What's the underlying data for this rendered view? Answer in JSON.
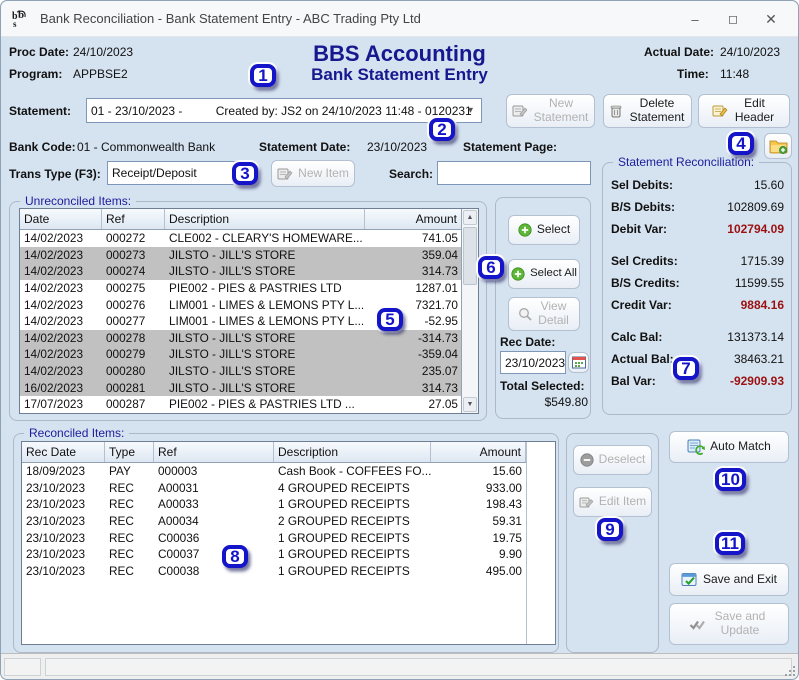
{
  "window": {
    "title": "Bank Reconciliation - Bank Statement Entry - ABC Trading Pty Ltd"
  },
  "header": {
    "proc_date_label": "Proc Date:",
    "proc_date": "24/10/2023",
    "program_label": "Program:",
    "program": "APPBSE2",
    "app_title": "BBS Accounting",
    "screen_title": "Bank Statement Entry",
    "actual_date_label": "Actual Date:",
    "actual_date": "24/10/2023",
    "time_label": "Time:",
    "time": "11:48"
  },
  "statement_bar": {
    "label": "Statement:",
    "value": "01 - 23/10/2023 -          Created by: JS2 on 24/10/2023 11:48 - 0120231",
    "new_statement": "New Statement",
    "delete_statement": "Delete Statement",
    "edit_header": "Edit Header"
  },
  "bank_row": {
    "bank_code_label": "Bank Code:",
    "bank_code": "01 - Commonwealth Bank",
    "statement_date_label": "Statement Date:",
    "statement_date": "23/10/2023",
    "statement_page_label": "Statement Page:",
    "statement_page": ""
  },
  "trans_row": {
    "trans_type_label": "Trans Type (F3):",
    "trans_type": "Receipt/Deposit",
    "new_item": "New Item",
    "search_label": "Search:",
    "search_value": ""
  },
  "unreconciled": {
    "title": "Unreconciled Items:",
    "columns": [
      "Date",
      "Ref",
      "Description",
      "Amount"
    ],
    "rows": [
      {
        "date": "14/02/2023",
        "ref": "000272",
        "description": "CLE002 - CLEARY'S HOMEWARE...",
        "amount": "741.05",
        "selected": false
      },
      {
        "date": "14/02/2023",
        "ref": "000273",
        "description": "JILSTO - JILL'S STORE",
        "amount": "359.04",
        "selected": true
      },
      {
        "date": "14/02/2023",
        "ref": "000274",
        "description": "JILSTO - JILL'S STORE",
        "amount": "314.73",
        "selected": true
      },
      {
        "date": "14/02/2023",
        "ref": "000275",
        "description": "PIE002 - PIES & PASTRIES LTD",
        "amount": "1287.01",
        "selected": false
      },
      {
        "date": "14/02/2023",
        "ref": "000276",
        "description": "LIM001 - LIMES & LEMONS PTY L...",
        "amount": "7321.70",
        "selected": false
      },
      {
        "date": "14/02/2023",
        "ref": "000277",
        "description": "LIM001 - LIMES & LEMONS PTY L...",
        "amount": "-52.95",
        "selected": false
      },
      {
        "date": "14/02/2023",
        "ref": "000278",
        "description": "JILSTO - JILL'S STORE",
        "amount": "-314.73",
        "selected": true
      },
      {
        "date": "14/02/2023",
        "ref": "000279",
        "description": "JILSTO - JILL'S STORE",
        "amount": "-359.04",
        "selected": true
      },
      {
        "date": "14/02/2023",
        "ref": "000280",
        "description": "JILSTO - JILL'S STORE",
        "amount": "235.07",
        "selected": true
      },
      {
        "date": "16/02/2023",
        "ref": "000281",
        "description": "JILSTO - JILL'S STORE",
        "amount": "314.73",
        "selected": true
      },
      {
        "date": "17/07/2023",
        "ref": "000287",
        "description": "PIE002 - PIES & PASTRIES LTD ...",
        "amount": "27.05",
        "selected": false
      }
    ],
    "select": "Select",
    "select_all": "Select All",
    "view_detail": "View Detail",
    "rec_date_label": "Rec Date:",
    "rec_date": "23/10/2023",
    "total_selected_label": "Total Selected:",
    "total_selected": "$549.80"
  },
  "reconciliation": {
    "title": "Statement Reconciliation:",
    "rows": [
      {
        "label": "Sel Debits:",
        "value": "15.60",
        "red": false,
        "gap": false
      },
      {
        "label": "B/S Debits:",
        "value": "102809.69",
        "red": false,
        "gap": false
      },
      {
        "label": "Debit Var:",
        "value": "102794.09",
        "red": true,
        "gap": false
      },
      {
        "label": "Sel Credits:",
        "value": "1715.39",
        "red": false,
        "gap": true
      },
      {
        "label": "B/S Credits:",
        "value": "11599.55",
        "red": false,
        "gap": false
      },
      {
        "label": "Credit Var:",
        "value": "9884.16",
        "red": true,
        "gap": false
      },
      {
        "label": "Calc Bal:",
        "value": "131373.14",
        "red": false,
        "gap": true
      },
      {
        "label": "Actual Bal:",
        "value": "38463.21",
        "red": false,
        "gap": false
      },
      {
        "label": "Bal Var:",
        "value": "-92909.93",
        "red": true,
        "gap": false
      }
    ]
  },
  "reconciled": {
    "title": "Reconciled Items:",
    "columns": [
      "Rec Date",
      "Type",
      "Ref",
      "Description",
      "Amount"
    ],
    "rows": [
      {
        "rec_date": "18/09/2023",
        "type": "PAY",
        "ref": "000003",
        "description": "Cash Book - COFFEES FO...",
        "amount": "15.60"
      },
      {
        "rec_date": "23/10/2023",
        "type": "REC",
        "ref": "A00031",
        "description": "4 GROUPED RECEIPTS",
        "amount": "933.00"
      },
      {
        "rec_date": "23/10/2023",
        "type": "REC",
        "ref": "A00033",
        "description": "1 GROUPED RECEIPTS",
        "amount": "198.43"
      },
      {
        "rec_date": "23/10/2023",
        "type": "REC",
        "ref": "A00034",
        "description": "2 GROUPED RECEIPTS",
        "amount": "59.31"
      },
      {
        "rec_date": "23/10/2023",
        "type": "REC",
        "ref": "C00036",
        "description": "1 GROUPED RECEIPTS",
        "amount": "19.75"
      },
      {
        "rec_date": "23/10/2023",
        "type": "REC",
        "ref": "C00037",
        "description": "1 GROUPED RECEIPTS",
        "amount": "9.90"
      },
      {
        "rec_date": "23/10/2023",
        "type": "REC",
        "ref": "C00038",
        "description": "1 GROUPED RECEIPTS",
        "amount": "495.00"
      }
    ],
    "deselect": "Deselect",
    "edit_item": "Edit Item"
  },
  "actions": {
    "auto_match": "Auto Match",
    "save_exit": "Save and Exit",
    "save_update": "Save and Update"
  },
  "badges": [
    "1",
    "2",
    "3",
    "4",
    "5",
    "6",
    "7",
    "8",
    "9",
    "10",
    "11"
  ],
  "colors": {
    "accent_navy": "#17178f",
    "alert_red": "#9b1111",
    "badge_blue": "#1414c8",
    "selected_row": "#c1c1c1"
  }
}
